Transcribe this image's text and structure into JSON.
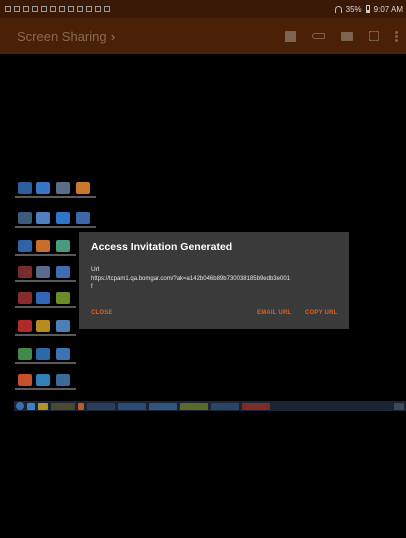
{
  "status_bar": {
    "battery": "35%",
    "time": "9:07 AM"
  },
  "app_bar": {
    "title": "Screen Sharing"
  },
  "dialog": {
    "title": "Access Invitation Generated",
    "url_label": "Url",
    "url": "https://tcpam1.qa.bomgar.com/?ak=a142b046b89b730038185b9edb3e001f",
    "close_label": "CLOSE",
    "email_label": "EMAIL URL",
    "copy_label": "COPY URL"
  },
  "colors": {
    "accent": "#e0601e",
    "appbar": "#4a2007",
    "dialog_bg": "#3a3a3a"
  }
}
